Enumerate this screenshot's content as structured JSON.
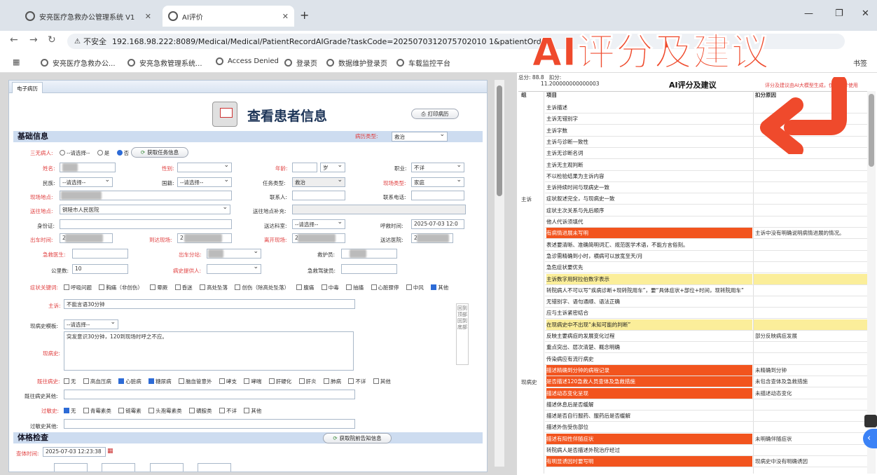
{
  "browser": {
    "tabs": [
      {
        "label": "安亮医疗急救办公管理系统 V1",
        "close": "✕"
      },
      {
        "label": "AI评价",
        "close": "✕"
      }
    ],
    "new_tab": "+",
    "window": {
      "minimize": "—",
      "maximize": "❐",
      "close": "✕"
    },
    "nav": {
      "back": "←",
      "forward": "→",
      "reload": "↻"
    },
    "url_warning": "⚠",
    "url_security": "不安全",
    "url": "192.168.98.222:8089/Medical/Medical/PatientRecordAIGrade?taskCode=2025070312075702010 1&patientOrde",
    "bookmarks": [
      "安亮医疗急救办公...",
      "安亮急救管理系统...",
      "Access Denied",
      "登录页",
      "数据维护登录页",
      "车载监控平台"
    ],
    "bookmarks_right": "书签"
  },
  "left": {
    "tab": "电子病历",
    "title": "查看患者信息",
    "print_btn": "打印病历",
    "section_basic": "基础信息",
    "record_type_label": "病历类型:",
    "record_type_value": "救治",
    "sanwu_label": "三无病人:",
    "sanwu_options": [
      "--请选择--",
      "是",
      "否"
    ],
    "get_task_btn": "获取任务信息",
    "name_label": "姓名:",
    "gender_label": "性别:",
    "age_label": "年龄:",
    "age_unit": "岁",
    "job_label": "职业:",
    "job_value": "不详",
    "ethnic_label": "民族:",
    "ethnic_value": "--请选择--",
    "nation_label": "国籍:",
    "nation_value": "--请选择--",
    "tasktype_label": "任务类型:",
    "tasktype_value": "救治",
    "scenetype_label": "现场类型:",
    "scenetype_value": "家庭",
    "sceneaddr_label": "现场地点:",
    "contact_label": "联系人:",
    "phone_label": "联系电话:",
    "dest_label": "送往地点:",
    "dest_value": "铜陵市人民医院",
    "dest_extra_label": "送往地点补充:",
    "id_label": "身份证:",
    "dept_label": "送达科室:",
    "dept_value": "--请选择--",
    "call_label": "呼救时间:",
    "call_value": "2025-07-03 12:0",
    "depart_label": "出车时间:",
    "depart_value": "2",
    "arrive_label": "到达现场:",
    "arrive_value": "2",
    "leave_label": "离开现场:",
    "leave_value": "2",
    "hosp_label": "送达医院:",
    "hosp_value": "2",
    "doctor_label": "急救医生:",
    "station_label": "出车分站:",
    "rescuer_label": "救护员:",
    "km_label": "公里数:",
    "km_value": "10",
    "history_provider_label": "病史提供人:",
    "driver_label": "急救驾驶员:",
    "symptom_label": "症状关键词:",
    "symptoms": [
      "呼吸问题",
      "胸痛（非创伤）",
      "晕厥",
      "昏迷",
      "高处坠落",
      "创伤（除高处坠落）",
      "腹痛",
      "中毒",
      "抽搐",
      "心脏骤停",
      "中风",
      "其他"
    ],
    "chief_label": "主诉:",
    "chief_value": "不能言语30分钟",
    "template_label": "现病史模板:",
    "template_value": "--请选择--",
    "present_label": "现病史:",
    "present_value": "突发意识30分钟，120到现场时呼之不应。",
    "past_label": "既往病史:",
    "past_items": [
      "无",
      "高血压病",
      "心脏病",
      "糖尿病",
      "脑血管意外",
      "哮支",
      "哮喘",
      "肝硬化",
      "肝炎",
      "肺病",
      "不详",
      "其他"
    ],
    "past_other_label": "既往病史其他:",
    "allergy_label": "过敏史:",
    "allergy_items": [
      "无",
      "青霉素类",
      "链霉素",
      "头孢霉素类",
      "磺胺类",
      "不详",
      "其他"
    ],
    "allergy_other_label": "过敏史其他:",
    "section_exam": "体格检查",
    "get_prehos_btn": "获取院前告知信息",
    "exam_time_label": "查体时间:",
    "exam_time_value": "2025-07-03 12:23:38",
    "float_bar": "回到顶部 回到底部"
  },
  "right": {
    "total_label": "总分:",
    "total_value": "88.8",
    "deduct_label": "扣分:",
    "deduct_value": "11.200000000000003",
    "title": "AI评分及建议",
    "note": "评分及建议由AI大模型生成，仅供参考使用",
    "col_group": "组",
    "col_item": "项目",
    "col_reason": "扣分原因",
    "group_chief": "主诉",
    "group_present": "现病史",
    "rows": [
      {
        "item": "主诉描述",
        "reason": "",
        "hl": ""
      },
      {
        "item": "主诉无错别字",
        "reason": "",
        "hl": ""
      },
      {
        "item": "主诉字数",
        "reason": "",
        "hl": ""
      },
      {
        "item": "主诉与诊断一致性",
        "reason": "",
        "hl": ""
      },
      {
        "item": "主诉无诊断名词",
        "reason": "",
        "hl": ""
      },
      {
        "item": "主诉无主观判断",
        "reason": "",
        "hl": ""
      },
      {
        "item": "不以检验结果为主诉内容",
        "reason": "",
        "hl": ""
      },
      {
        "item": "主诉持续时间与现病史一致",
        "reason": "",
        "hl": ""
      },
      {
        "item": "症状叙述完全，与现病史一致",
        "reason": "",
        "hl": ""
      },
      {
        "item": "症状主次关系与先后顺序",
        "reason": "",
        "hl": ""
      },
      {
        "item": "他人代诉须填代",
        "reason": "",
        "hl": ""
      },
      {
        "item": "有病情进展未写明",
        "reason": "主诉中没有明确说明病情进展的情况。",
        "hl": "r"
      },
      {
        "item": "表述要清晰、准确简明词汇、规范医学术语，不能方言俗刻。",
        "reason": "",
        "hl": ""
      },
      {
        "item": "急诊需精确到小时，横病可以放宽至天/月",
        "reason": "",
        "hl": ""
      },
      {
        "item": "急危症状要优先",
        "reason": "",
        "hl": ""
      },
      {
        "item": "主诉数字用阿拉伯数字表示",
        "reason": "",
        "hl": "y"
      },
      {
        "item": "转院病人不可以写“疾病诊断+现转院用车”，要“具体症状+部位+时间，现转院用车”",
        "reason": "",
        "hl": ""
      },
      {
        "item": "无错别字、语句通顺、语法正确",
        "reason": "",
        "hl": ""
      },
      {
        "item": "应与主诉紧密结合",
        "reason": "",
        "hl": ""
      },
      {
        "item": "在现病史中不出现“未知可能的判断”",
        "reason": "",
        "hl": "y"
      },
      {
        "item": "反映主要病症的发展变化过程",
        "reason": "部分反映病症发展",
        "hl": ""
      },
      {
        "item": "重点突出、层次清楚、概念明确",
        "reason": "",
        "hl": ""
      },
      {
        "item": "传染病应有流行病史",
        "reason": "",
        "hl": ""
      },
      {
        "item": "描述精确到分钟的病程记录",
        "reason": "未精确到分钟",
        "hl": "r"
      },
      {
        "item": "是否描述120急救人员查体及急救措施",
        "reason": "未包含查体及急救措施",
        "hl": "r"
      },
      {
        "item": "描述动态变化呈现",
        "reason": "未描述动态变化",
        "hl": "r"
      },
      {
        "item": "描述休息后是否缓解",
        "reason": "",
        "hl": ""
      },
      {
        "item": "描述是否自行服药、服药后是否缓解",
        "reason": "",
        "hl": ""
      },
      {
        "item": "描述外伤受伤部位",
        "reason": "",
        "hl": ""
      },
      {
        "item": "描述有阳性伴随症状",
        "reason": "未明确伴随症状",
        "hl": "r"
      },
      {
        "item": "转院病人是否描述外院治疗经过",
        "reason": "",
        "hl": ""
      },
      {
        "item": "有明显诱因时要写明",
        "reason": "现病史中没有明确诱因",
        "hl": "r"
      }
    ]
  },
  "overlay": {
    "title": "AI评分及建议"
  },
  "colors": {
    "accent": "#ef4a2c",
    "highlight_red": "#f2541e",
    "highlight_yellow": "#fbee9a"
  }
}
